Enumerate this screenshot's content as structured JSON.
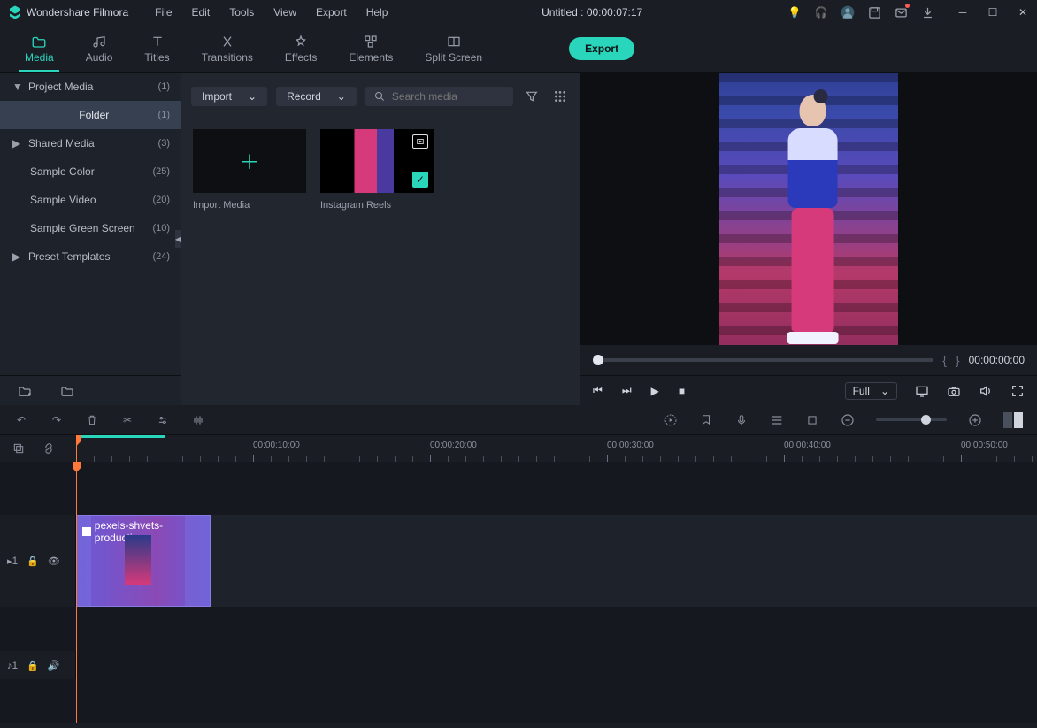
{
  "app_name": "Wondershare Filmora",
  "title_center": "Untitled : 00:00:07:17",
  "menu": [
    "File",
    "Edit",
    "Tools",
    "View",
    "Export",
    "Help"
  ],
  "tabs": [
    {
      "label": "Media",
      "active": true
    },
    {
      "label": "Audio"
    },
    {
      "label": "Titles"
    },
    {
      "label": "Transitions"
    },
    {
      "label": "Effects"
    },
    {
      "label": "Elements"
    },
    {
      "label": "Split Screen"
    }
  ],
  "export_button": "Export",
  "sidebar": [
    {
      "label": "Project Media",
      "count": "(1)",
      "chev": "▼"
    },
    {
      "label": "Folder",
      "count": "(1)",
      "indent": true,
      "selected": true
    },
    {
      "label": "Shared Media",
      "count": "(3)",
      "chev": "▶"
    },
    {
      "label": "Sample Color",
      "count": "(25)",
      "indent": true
    },
    {
      "label": "Sample Video",
      "count": "(20)",
      "indent": true
    },
    {
      "label": "Sample Green Screen",
      "count": "(10)",
      "indent": true
    },
    {
      "label": "Preset Templates",
      "count": "(24)",
      "chev": "▶"
    }
  ],
  "panel": {
    "import_label": "Import",
    "record_label": "Record",
    "search_placeholder": "Search media",
    "items": [
      {
        "label": "Import Media",
        "type": "add"
      },
      {
        "label": "Instagram Reels",
        "type": "clip"
      }
    ]
  },
  "preview": {
    "timecode": "00:00:00:00",
    "quality": "Full"
  },
  "ruler_marks": [
    "00:00:10:00",
    "00:00:20:00",
    "00:00:30:00",
    "00:00:40:00",
    "00:00:50:00"
  ],
  "clip": {
    "label": "pexels-shvets-productio"
  },
  "track_video": "1",
  "track_audio": "1"
}
